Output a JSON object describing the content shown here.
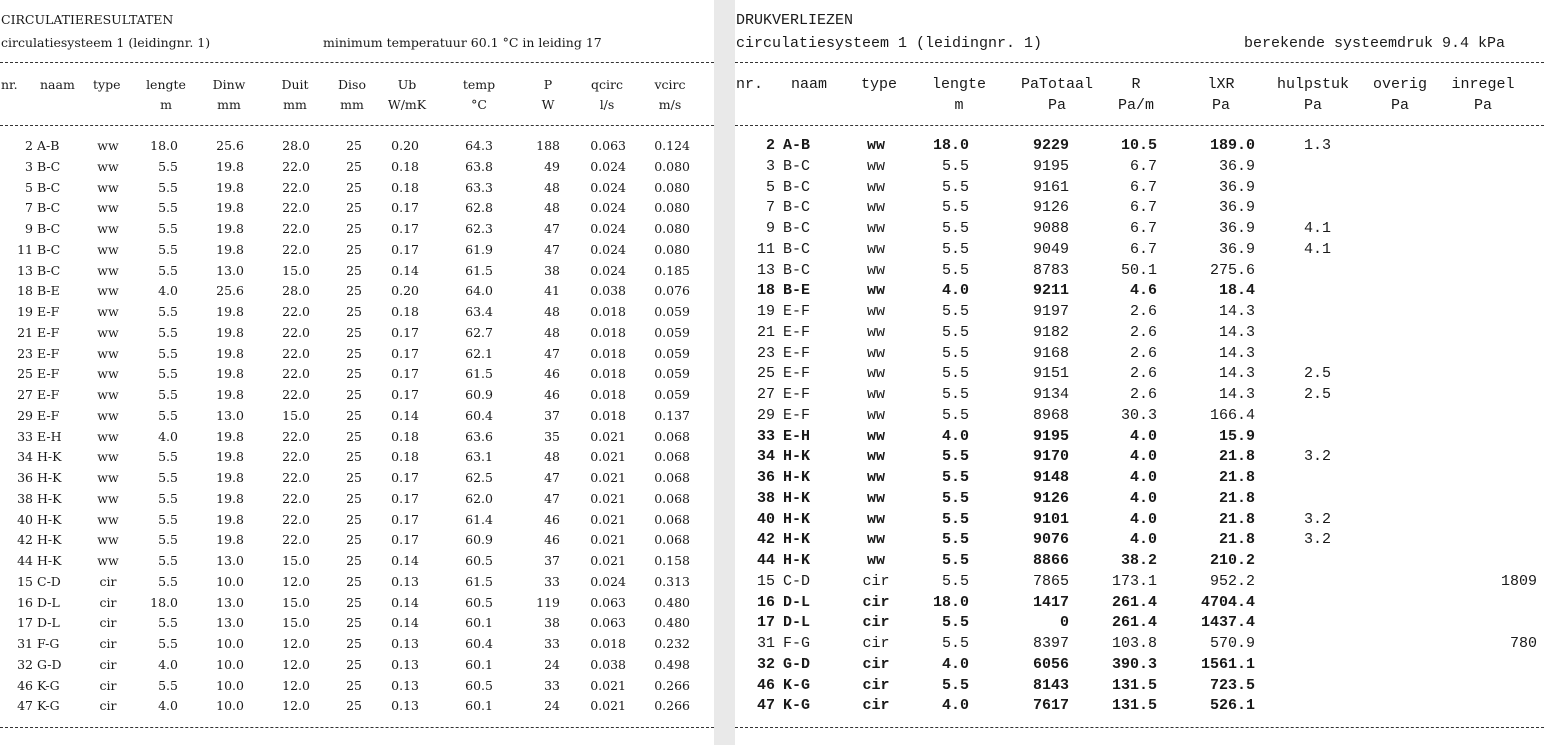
{
  "circ": {
    "title": "CIRCULATIERESULTATEN",
    "system": "circulatiesysteem 1 (leidingnr. 1)",
    "min_temp": "minimum temperatuur 60.1 °C  in leiding 17",
    "headers": [
      "nr.",
      "naam",
      "type",
      "lengte",
      "Dinw",
      "Duit",
      "Diso",
      "Ub",
      "temp",
      "P",
      "qcirc",
      "vcirc"
    ],
    "units": [
      "",
      "",
      "",
      "m",
      "mm",
      "mm",
      "mm",
      "W/mK",
      "°C",
      "W",
      "l/s",
      "m/s"
    ],
    "rows": [
      [
        "2",
        "A-B",
        "ww",
        "18.0",
        "25.6",
        "28.0",
        "25",
        "0.20",
        "64.3",
        "188",
        "0.063",
        "0.124"
      ],
      [
        "3",
        "B-C",
        "ww",
        "5.5",
        "19.8",
        "22.0",
        "25",
        "0.18",
        "63.8",
        "49",
        "0.024",
        "0.080"
      ],
      [
        "5",
        "B-C",
        "ww",
        "5.5",
        "19.8",
        "22.0",
        "25",
        "0.18",
        "63.3",
        "48",
        "0.024",
        "0.080"
      ],
      [
        "7",
        "B-C",
        "ww",
        "5.5",
        "19.8",
        "22.0",
        "25",
        "0.17",
        "62.8",
        "48",
        "0.024",
        "0.080"
      ],
      [
        "9",
        "B-C",
        "ww",
        "5.5",
        "19.8",
        "22.0",
        "25",
        "0.17",
        "62.3",
        "47",
        "0.024",
        "0.080"
      ],
      [
        "11",
        "B-C",
        "ww",
        "5.5",
        "19.8",
        "22.0",
        "25",
        "0.17",
        "61.9",
        "47",
        "0.024",
        "0.080"
      ],
      [
        "13",
        "B-C",
        "ww",
        "5.5",
        "13.0",
        "15.0",
        "25",
        "0.14",
        "61.5",
        "38",
        "0.024",
        "0.185"
      ],
      [
        "18",
        "B-E",
        "ww",
        "4.0",
        "25.6",
        "28.0",
        "25",
        "0.20",
        "64.0",
        "41",
        "0.038",
        "0.076"
      ],
      [
        "19",
        "E-F",
        "ww",
        "5.5",
        "19.8",
        "22.0",
        "25",
        "0.18",
        "63.4",
        "48",
        "0.018",
        "0.059"
      ],
      [
        "21",
        "E-F",
        "ww",
        "5.5",
        "19.8",
        "22.0",
        "25",
        "0.17",
        "62.7",
        "48",
        "0.018",
        "0.059"
      ],
      [
        "23",
        "E-F",
        "ww",
        "5.5",
        "19.8",
        "22.0",
        "25",
        "0.17",
        "62.1",
        "47",
        "0.018",
        "0.059"
      ],
      [
        "25",
        "E-F",
        "ww",
        "5.5",
        "19.8",
        "22.0",
        "25",
        "0.17",
        "61.5",
        "46",
        "0.018",
        "0.059"
      ],
      [
        "27",
        "E-F",
        "ww",
        "5.5",
        "19.8",
        "22.0",
        "25",
        "0.17",
        "60.9",
        "46",
        "0.018",
        "0.059"
      ],
      [
        "29",
        "E-F",
        "ww",
        "5.5",
        "13.0",
        "15.0",
        "25",
        "0.14",
        "60.4",
        "37",
        "0.018",
        "0.137"
      ],
      [
        "33",
        "E-H",
        "ww",
        "4.0",
        "19.8",
        "22.0",
        "25",
        "0.18",
        "63.6",
        "35",
        "0.021",
        "0.068"
      ],
      [
        "34",
        "H-K",
        "ww",
        "5.5",
        "19.8",
        "22.0",
        "25",
        "0.18",
        "63.1",
        "48",
        "0.021",
        "0.068"
      ],
      [
        "36",
        "H-K",
        "ww",
        "5.5",
        "19.8",
        "22.0",
        "25",
        "0.17",
        "62.5",
        "47",
        "0.021",
        "0.068"
      ],
      [
        "38",
        "H-K",
        "ww",
        "5.5",
        "19.8",
        "22.0",
        "25",
        "0.17",
        "62.0",
        "47",
        "0.021",
        "0.068"
      ],
      [
        "40",
        "H-K",
        "ww",
        "5.5",
        "19.8",
        "22.0",
        "25",
        "0.17",
        "61.4",
        "46",
        "0.021",
        "0.068"
      ],
      [
        "42",
        "H-K",
        "ww",
        "5.5",
        "19.8",
        "22.0",
        "25",
        "0.17",
        "60.9",
        "46",
        "0.021",
        "0.068"
      ],
      [
        "44",
        "H-K",
        "ww",
        "5.5",
        "13.0",
        "15.0",
        "25",
        "0.14",
        "60.5",
        "37",
        "0.021",
        "0.158"
      ],
      [
        "15",
        "C-D",
        "cir",
        "5.5",
        "10.0",
        "12.0",
        "25",
        "0.13",
        "61.5",
        "33",
        "0.024",
        "0.313"
      ],
      [
        "16",
        "D-L",
        "cir",
        "18.0",
        "13.0",
        "15.0",
        "25",
        "0.14",
        "60.5",
        "119",
        "0.063",
        "0.480"
      ],
      [
        "17",
        "D-L",
        "cir",
        "5.5",
        "13.0",
        "15.0",
        "25",
        "0.14",
        "60.1",
        "38",
        "0.063",
        "0.480"
      ],
      [
        "31",
        "F-G",
        "cir",
        "5.5",
        "10.0",
        "12.0",
        "25",
        "0.13",
        "60.4",
        "33",
        "0.018",
        "0.232"
      ],
      [
        "32",
        "G-D",
        "cir",
        "4.0",
        "10.0",
        "12.0",
        "25",
        "0.13",
        "60.1",
        "24",
        "0.038",
        "0.498"
      ],
      [
        "46",
        "K-G",
        "cir",
        "5.5",
        "10.0",
        "12.0",
        "25",
        "0.13",
        "60.5",
        "33",
        "0.021",
        "0.266"
      ],
      [
        "47",
        "K-G",
        "cir",
        "4.0",
        "10.0",
        "12.0",
        "25",
        "0.13",
        "60.1",
        "24",
        "0.021",
        "0.266"
      ]
    ]
  },
  "druk": {
    "title": "DRUKVERLIEZEN",
    "system": "circulatiesysteem 1 (leidingnr. 1)",
    "pressure": "berekende systeemdruk 9.4 kPa",
    "headers": [
      "nr.",
      "naam",
      "type",
      "lengte",
      "PaTotaal",
      "R",
      "lXR",
      "hulpstuk",
      "overig",
      "inregel"
    ],
    "units": [
      "",
      "",
      "",
      "m",
      "Pa",
      "Pa/m",
      "Pa",
      "Pa",
      "Pa",
      "Pa"
    ],
    "rows": [
      {
        "nr": "2",
        "naam": "A-B",
        "type": "ww",
        "lengte": "18.0",
        "pa": "9229",
        "r": "10.5",
        "lxr": "189.0",
        "hulp": "1.3",
        "overig": "",
        "inregel": "",
        "b": true
      },
      {
        "nr": "3",
        "naam": "B-C",
        "type": "ww",
        "lengte": "5.5",
        "pa": "9195",
        "r": "6.7",
        "lxr": "36.9",
        "hulp": "",
        "overig": "",
        "inregel": "",
        "b": false
      },
      {
        "nr": "5",
        "naam": "B-C",
        "type": "ww",
        "lengte": "5.5",
        "pa": "9161",
        "r": "6.7",
        "lxr": "36.9",
        "hulp": "",
        "overig": "",
        "inregel": "",
        "b": false
      },
      {
        "nr": "7",
        "naam": "B-C",
        "type": "ww",
        "lengte": "5.5",
        "pa": "9126",
        "r": "6.7",
        "lxr": "36.9",
        "hulp": "",
        "overig": "",
        "inregel": "",
        "b": false
      },
      {
        "nr": "9",
        "naam": "B-C",
        "type": "ww",
        "lengte": "5.5",
        "pa": "9088",
        "r": "6.7",
        "lxr": "36.9",
        "hulp": "4.1",
        "overig": "",
        "inregel": "",
        "b": false
      },
      {
        "nr": "11",
        "naam": "B-C",
        "type": "ww",
        "lengte": "5.5",
        "pa": "9049",
        "r": "6.7",
        "lxr": "36.9",
        "hulp": "4.1",
        "overig": "",
        "inregel": "",
        "b": false
      },
      {
        "nr": "13",
        "naam": "B-C",
        "type": "ww",
        "lengte": "5.5",
        "pa": "8783",
        "r": "50.1",
        "lxr": "275.6",
        "hulp": "",
        "overig": "",
        "inregel": "",
        "b": false
      },
      {
        "nr": "18",
        "naam": "B-E",
        "type": "ww",
        "lengte": "4.0",
        "pa": "9211",
        "r": "4.6",
        "lxr": "18.4",
        "hulp": "",
        "overig": "",
        "inregel": "",
        "b": true
      },
      {
        "nr": "19",
        "naam": "E-F",
        "type": "ww",
        "lengte": "5.5",
        "pa": "9197",
        "r": "2.6",
        "lxr": "14.3",
        "hulp": "",
        "overig": "",
        "inregel": "",
        "b": false
      },
      {
        "nr": "21",
        "naam": "E-F",
        "type": "ww",
        "lengte": "5.5",
        "pa": "9182",
        "r": "2.6",
        "lxr": "14.3",
        "hulp": "",
        "overig": "",
        "inregel": "",
        "b": false
      },
      {
        "nr": "23",
        "naam": "E-F",
        "type": "ww",
        "lengte": "5.5",
        "pa": "9168",
        "r": "2.6",
        "lxr": "14.3",
        "hulp": "",
        "overig": "",
        "inregel": "",
        "b": false
      },
      {
        "nr": "25",
        "naam": "E-F",
        "type": "ww",
        "lengte": "5.5",
        "pa": "9151",
        "r": "2.6",
        "lxr": "14.3",
        "hulp": "2.5",
        "overig": "",
        "inregel": "",
        "b": false
      },
      {
        "nr": "27",
        "naam": "E-F",
        "type": "ww",
        "lengte": "5.5",
        "pa": "9134",
        "r": "2.6",
        "lxr": "14.3",
        "hulp": "2.5",
        "overig": "",
        "inregel": "",
        "b": false
      },
      {
        "nr": "29",
        "naam": "E-F",
        "type": "ww",
        "lengte": "5.5",
        "pa": "8968",
        "r": "30.3",
        "lxr": "166.4",
        "hulp": "",
        "overig": "",
        "inregel": "",
        "b": false
      },
      {
        "nr": "33",
        "naam": "E-H",
        "type": "ww",
        "lengte": "4.0",
        "pa": "9195",
        "r": "4.0",
        "lxr": "15.9",
        "hulp": "",
        "overig": "",
        "inregel": "",
        "b": true
      },
      {
        "nr": "34",
        "naam": "H-K",
        "type": "ww",
        "lengte": "5.5",
        "pa": "9170",
        "r": "4.0",
        "lxr": "21.8",
        "hulp": "3.2",
        "overig": "",
        "inregel": "",
        "b": true
      },
      {
        "nr": "36",
        "naam": "H-K",
        "type": "ww",
        "lengte": "5.5",
        "pa": "9148",
        "r": "4.0",
        "lxr": "21.8",
        "hulp": "",
        "overig": "",
        "inregel": "",
        "b": true
      },
      {
        "nr": "38",
        "naam": "H-K",
        "type": "ww",
        "lengte": "5.5",
        "pa": "9126",
        "r": "4.0",
        "lxr": "21.8",
        "hulp": "",
        "overig": "",
        "inregel": "",
        "b": true
      },
      {
        "nr": "40",
        "naam": "H-K",
        "type": "ww",
        "lengte": "5.5",
        "pa": "9101",
        "r": "4.0",
        "lxr": "21.8",
        "hulp": "3.2",
        "overig": "",
        "inregel": "",
        "b": true
      },
      {
        "nr": "42",
        "naam": "H-K",
        "type": "ww",
        "lengte": "5.5",
        "pa": "9076",
        "r": "4.0",
        "lxr": "21.8",
        "hulp": "3.2",
        "overig": "",
        "inregel": "",
        "b": true
      },
      {
        "nr": "44",
        "naam": "H-K",
        "type": "ww",
        "lengte": "5.5",
        "pa": "8866",
        "r": "38.2",
        "lxr": "210.2",
        "hulp": "",
        "overig": "",
        "inregel": "",
        "b": true
      },
      {
        "nr": "15",
        "naam": "C-D",
        "type": "cir",
        "lengte": "5.5",
        "pa": "7865",
        "r": "173.1",
        "lxr": "952.2",
        "hulp": "",
        "overig": "",
        "inregel": "1809",
        "b": false
      },
      {
        "nr": "16",
        "naam": "D-L",
        "type": "cir",
        "lengte": "18.0",
        "pa": "1417",
        "r": "261.4",
        "lxr": "4704.4",
        "hulp": "",
        "overig": "",
        "inregel": "",
        "b": true
      },
      {
        "nr": "17",
        "naam": "D-L",
        "type": "cir",
        "lengte": "5.5",
        "pa": "0",
        "r": "261.4",
        "lxr": "1437.4",
        "hulp": "",
        "overig": "",
        "inregel": "",
        "b": true
      },
      {
        "nr": "31",
        "naam": "F-G",
        "type": "cir",
        "lengte": "5.5",
        "pa": "8397",
        "r": "103.8",
        "lxr": "570.9",
        "hulp": "",
        "overig": "",
        "inregel": "780",
        "b": false
      },
      {
        "nr": "32",
        "naam": "G-D",
        "type": "cir",
        "lengte": "4.0",
        "pa": "6056",
        "r": "390.3",
        "lxr": "1561.1",
        "hulp": "",
        "overig": "",
        "inregel": "",
        "b": true
      },
      {
        "nr": "46",
        "naam": "K-G",
        "type": "cir",
        "lengte": "5.5",
        "pa": "8143",
        "r": "131.5",
        "lxr": "723.5",
        "hulp": "",
        "overig": "",
        "inregel": "",
        "b": true
      },
      {
        "nr": "47",
        "naam": "K-G",
        "type": "cir",
        "lengte": "4.0",
        "pa": "7617",
        "r": "131.5",
        "lxr": "526.1",
        "hulp": "",
        "overig": "",
        "inregel": "",
        "b": true
      }
    ]
  }
}
